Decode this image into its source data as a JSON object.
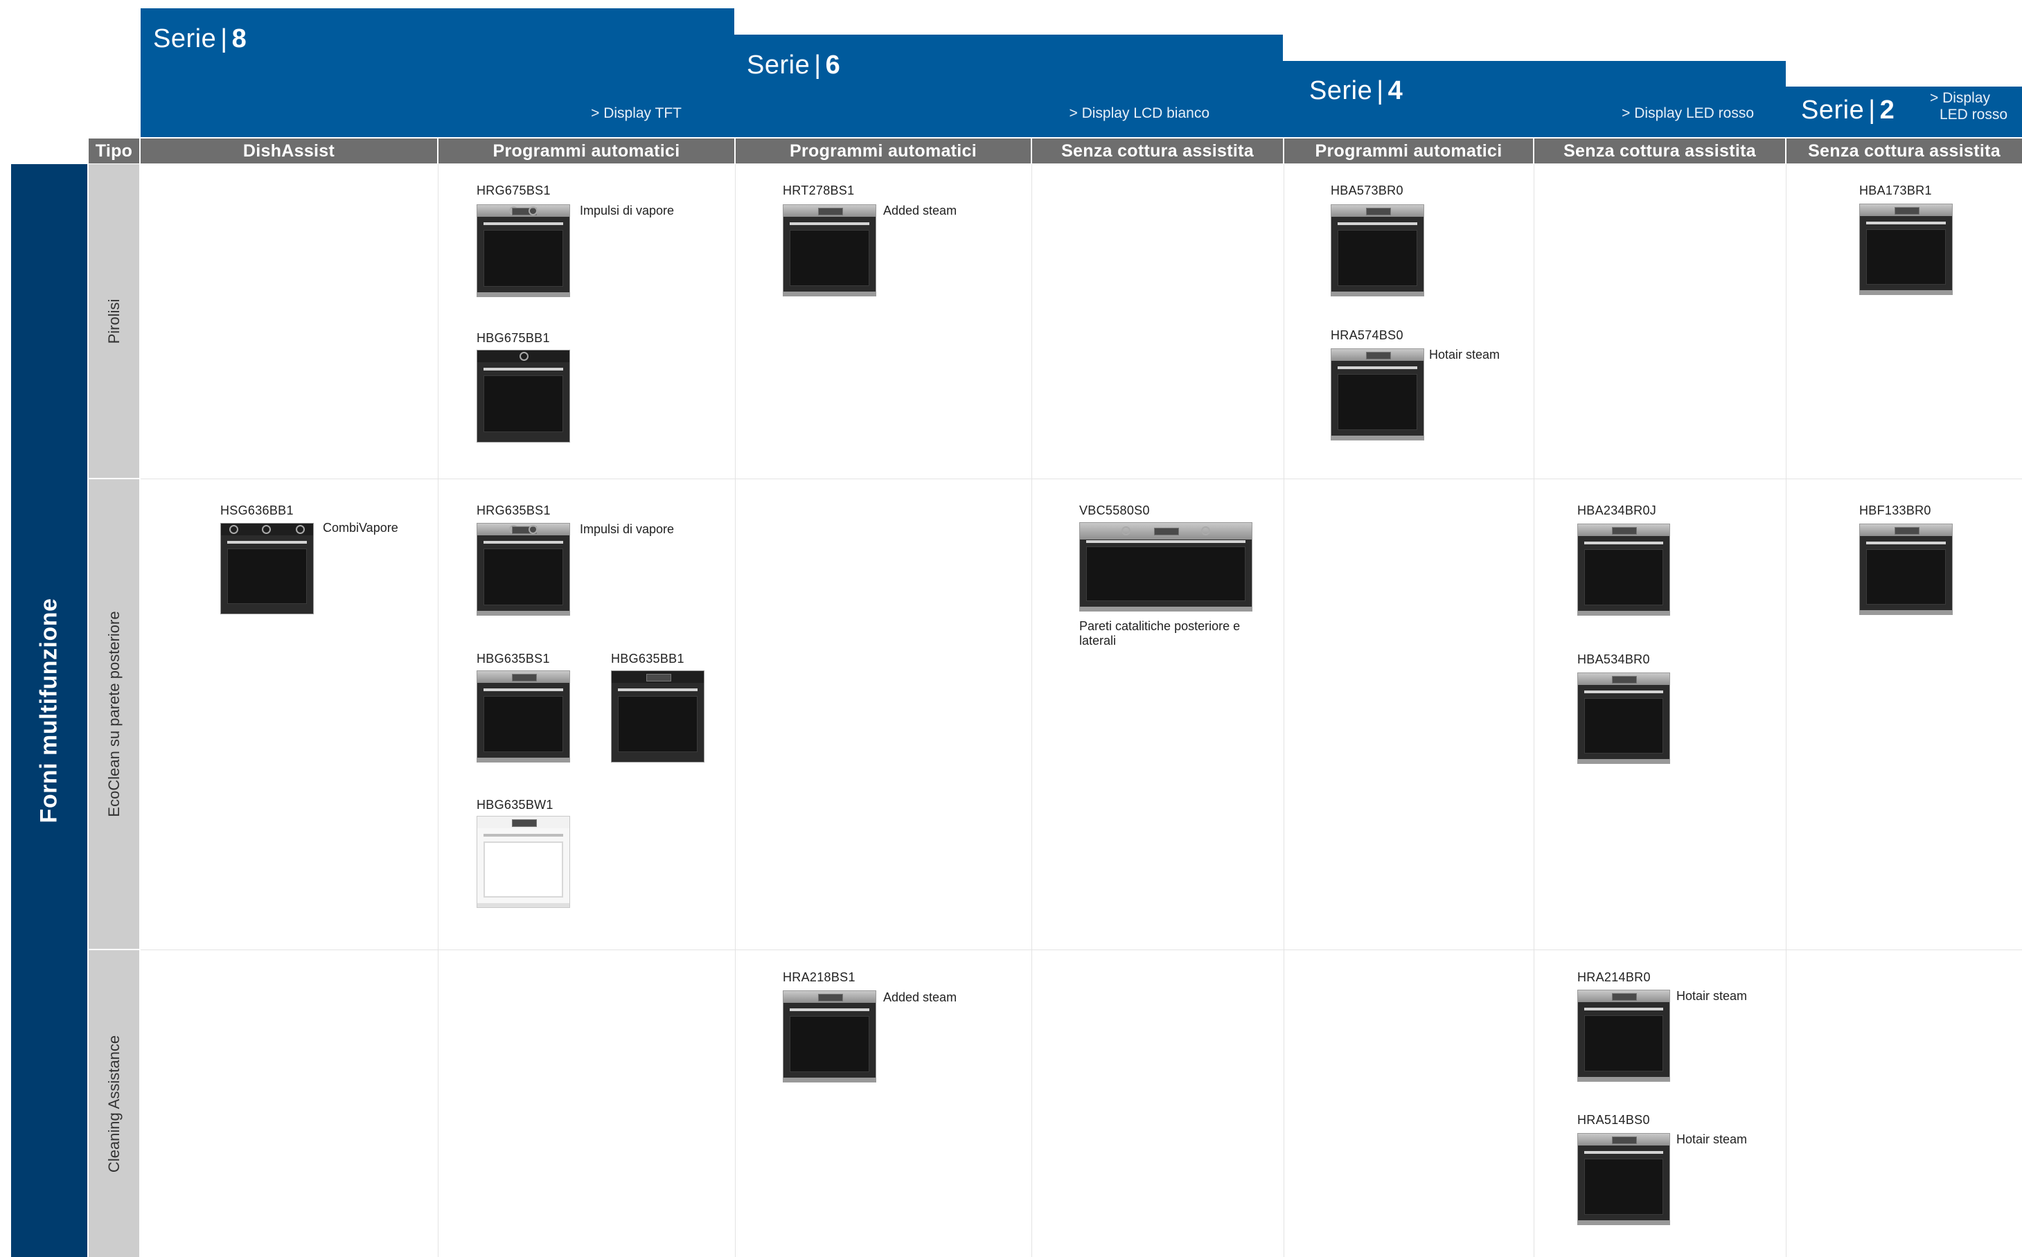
{
  "series": [
    {
      "prefix": "Serie",
      "number": "8",
      "subtitle": "> Display TFT"
    },
    {
      "prefix": "Serie",
      "number": "6",
      "subtitle": "> Display LCD bianco"
    },
    {
      "prefix": "Serie",
      "number": "4",
      "subtitle": "> Display LED rosso"
    },
    {
      "prefix": "Serie",
      "number": "2",
      "subtitle_line1": "> Display",
      "subtitle_line2": "LED rosso"
    }
  ],
  "separator": "|",
  "columns": {
    "tipo": "Tipo",
    "labels": [
      "DishAssist",
      "Programmi automatici",
      "Programmi automatici",
      "Senza cottura assistita",
      "Programmi automatici",
      "Senza cottura assistita",
      "Senza cottura assistita"
    ]
  },
  "category": "Forni multifunzione",
  "rows": [
    "Pirolisi",
    "EcoClean su parete posteriore",
    "Cleaning Assistance"
  ],
  "products": [
    {
      "model": "HRG675BS1",
      "feature": "Impulsi di vapore"
    },
    {
      "model": "HBG675BB1"
    },
    {
      "model": "HRT278BS1",
      "feature": "Added steam"
    },
    {
      "model": "HBA573BR0"
    },
    {
      "model": "HRA574BS0",
      "feature": "Hotair steam"
    },
    {
      "model": "HBA173BR1"
    },
    {
      "model": "HSG636BB1",
      "feature": "CombiVapore"
    },
    {
      "model": "HRG635BS1",
      "feature": "Impulsi di vapore"
    },
    {
      "model": "HBG635BS1"
    },
    {
      "model": "HBG635BB1"
    },
    {
      "model": "HBG635BW1"
    },
    {
      "model": "VBC5580S0",
      "note": "Pareti catalitiche posteriore e laterali"
    },
    {
      "model": "HBA234BR0J"
    },
    {
      "model": "HBA534BR0"
    },
    {
      "model": "HBF133BR0"
    },
    {
      "model": "HRA218BS1",
      "feature": "Added steam"
    },
    {
      "model": "HRA214BR0",
      "feature": "Hotair steam"
    },
    {
      "model": "HRA514BS0",
      "feature": "Hotair steam"
    }
  ],
  "colors": {
    "series_blue": "#005a9c",
    "header_gray": "#6e6e6e",
    "category_navy": "#003c6e",
    "row_label_gray": "#cdcdcd"
  }
}
